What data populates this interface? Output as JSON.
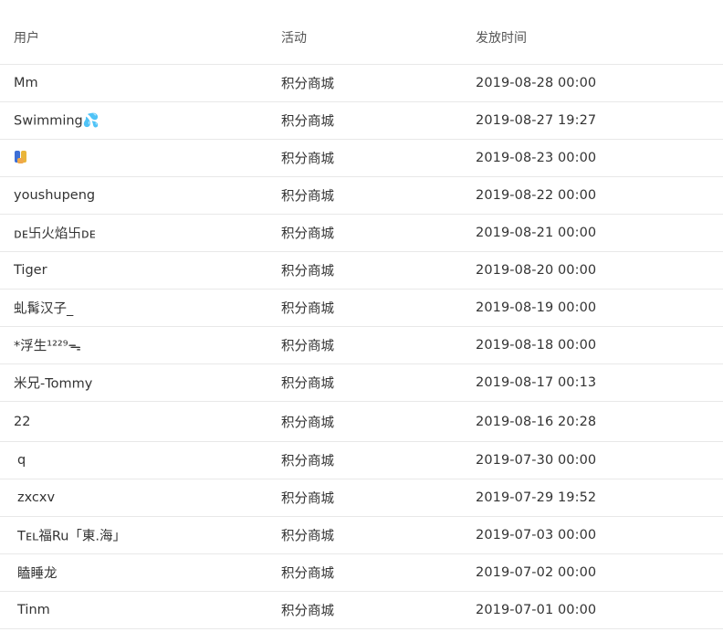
{
  "table": {
    "headers": {
      "user": "用户",
      "activity": "活动",
      "issue_time": "发放时间"
    },
    "rows": [
      {
        "user": "Mm",
        "activity": "积分商城",
        "time": "2019-08-28 00:00"
      },
      {
        "user": "Swimming💦",
        "activity": "积分商城",
        "time": "2019-08-27 19:27"
      },
      {
        "user": "",
        "user_icon": "emoji-icon",
        "activity": "积分商城",
        "time": "2019-08-23 00:00"
      },
      {
        "user": "youshupeng",
        "activity": "积分商城",
        "time": "2019-08-22 00:00"
      },
      {
        "user": "ᴅᴇ卐火焰卐ᴅᴇ",
        "activity": "积分商城",
        "time": "2019-08-21 00:00"
      },
      {
        "user": "Tiger",
        "activity": "积分商城",
        "time": "2019-08-20 00:00"
      },
      {
        "user": "虬髯汉子_",
        "activity": "积分商城",
        "time": "2019-08-19 00:00"
      },
      {
        "user": "*浮生¹²²⁹ᯓ",
        "activity": "积分商城",
        "time": "2019-08-18 00:00"
      },
      {
        "user": "米兄-Tommy",
        "activity": "积分商城",
        "time": "2019-08-17 00:13"
      },
      {
        "user": "22",
        "activity": "积分商城",
        "time": "2019-08-16 20:28"
      },
      {
        "user": "q",
        "activity": "积分商城",
        "time": "2019-07-30 00:00"
      },
      {
        "user": "zxcxv",
        "activity": "积分商城",
        "time": "2019-07-29 19:52"
      },
      {
        "user": "Tᴇʟ福Ru「東.海」",
        "activity": "积分商城",
        "time": "2019-07-03 00:00"
      },
      {
        "user": "瞌睡龙",
        "activity": "积分商城",
        "time": "2019-07-02 00:00"
      },
      {
        "user": "Tinm",
        "activity": "积分商城",
        "time": "2019-07-01 00:00"
      }
    ]
  }
}
